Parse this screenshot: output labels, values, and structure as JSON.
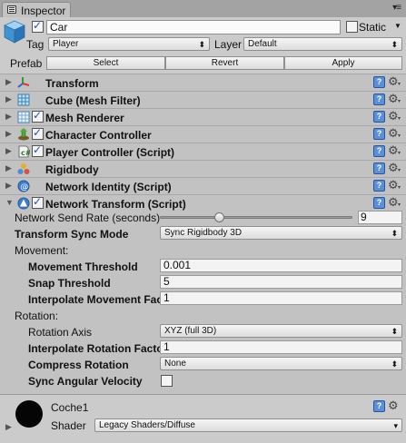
{
  "tab": {
    "title": "Inspector"
  },
  "header": {
    "active": true,
    "name": "Car",
    "static_label": "Static",
    "tag_label": "Tag",
    "tag_value": "Player",
    "layer_label": "Layer",
    "layer_value": "Default",
    "prefab_label": "Prefab",
    "prefab_buttons": [
      "Select",
      "Revert",
      "Apply"
    ]
  },
  "components": [
    {
      "name": "Transform",
      "icon": "transform-icon",
      "checkbox": false
    },
    {
      "name": "Cube (Mesh Filter)",
      "icon": "mesh-filter-icon",
      "checkbox": false
    },
    {
      "name": "Mesh Renderer",
      "icon": "mesh-renderer-icon",
      "checkbox": true
    },
    {
      "name": "Character Controller",
      "icon": "character-controller-icon",
      "checkbox": true
    },
    {
      "name": "Player Controller (Script)",
      "icon": "script-icon",
      "checkbox": true
    },
    {
      "name": "Rigidbody",
      "icon": "rigidbody-icon",
      "checkbox": false
    },
    {
      "name": "Network Identity (Script)",
      "icon": "network-identity-icon",
      "checkbox": false
    },
    {
      "name": "Network Transform (Script)",
      "icon": "network-transform-icon",
      "checkbox": true,
      "expanded": true
    }
  ],
  "network_transform": {
    "send_rate_label": "Network Send Rate (seconds)",
    "send_rate_value": "9",
    "send_rate_fraction": 0.3,
    "sync_mode_label": "Transform Sync Mode",
    "sync_mode_value": "Sync Rigidbody 3D",
    "movement_header": "Movement:",
    "movement_threshold_label": "Movement Threshold",
    "movement_threshold_value": "0.001",
    "snap_threshold_label": "Snap Threshold",
    "snap_threshold_value": "5",
    "interp_movement_label": "Interpolate Movement Fac",
    "interp_movement_value": "1",
    "rotation_header": "Rotation:",
    "rotation_axis_label": "Rotation Axis",
    "rotation_axis_value": "XYZ (full 3D)",
    "interp_rotation_label": "Interpolate Rotation Facto",
    "interp_rotation_value": "1",
    "compress_rotation_label": "Compress Rotation",
    "compress_rotation_value": "None",
    "sync_angular_label": "Sync Angular Velocity",
    "sync_angular_checked": false
  },
  "material": {
    "name": "Coche1",
    "shader_label": "Shader",
    "shader_value": "Legacy Shaders/Diffuse"
  },
  "colors": {
    "help_blue": "#5b8fd8",
    "panel": "#c2c2c2",
    "material_ball": "#050505"
  }
}
